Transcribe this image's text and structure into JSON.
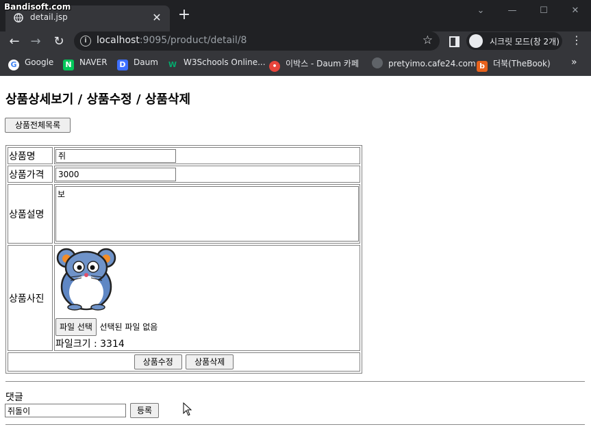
{
  "watermark": "Bandisoft.com",
  "browser": {
    "tab_title": "detail.jsp",
    "url_host": "localhost",
    "url_rest": ":9095/product/detail/8",
    "incognito_label": "시크릿 모드(창 2개)",
    "bookmarks": [
      {
        "label": "Google",
        "icon": "google-icon",
        "color": "#4285f4"
      },
      {
        "label": "NAVER",
        "icon": "naver-icon",
        "color": "#03c75a"
      },
      {
        "label": "Daum",
        "icon": "daum-icon",
        "color": "#f5a623"
      },
      {
        "label": "W3Schools Online...",
        "icon": "w3schools-icon",
        "color": "#04aa6d"
      },
      {
        "label": "이박스 - Daum 카페",
        "icon": "daum-cafe-icon",
        "color": "#e8453c"
      },
      {
        "label": "pretyimo.cafe24.com",
        "icon": "globe-icon",
        "color": "#9aa0a6"
      },
      {
        "label": "더북(TheBook)",
        "icon": "thebook-icon",
        "color": "#e8621c"
      }
    ]
  },
  "page": {
    "heading": "상품상세보기 / 상품수정 / 상품삭제",
    "list_button": "상품전체목록",
    "form": {
      "name_label": "상품명",
      "name_value": "쥐",
      "price_label": "상품가격",
      "price_value": "3000",
      "desc_label": "상품설명",
      "desc_value": "보",
      "photo_label": "상품사진",
      "file_button": "파일 선택",
      "file_status": "선택된 파일 없음",
      "file_size": "파일크기 : 3314",
      "update_button": "상품수정",
      "delete_button": "상품삭제"
    },
    "comment": {
      "label": "댓글",
      "input_value": "쥐돌이",
      "submit_button": "등록"
    }
  }
}
